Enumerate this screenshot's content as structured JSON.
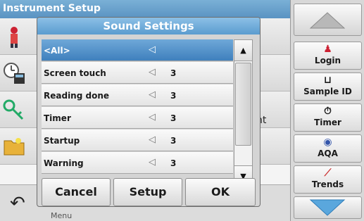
{
  "background": {
    "title": "Instrument Setup",
    "partial_label": "nt",
    "bottom_label": "Menu",
    "back_icon": "undo-icon"
  },
  "dialog": {
    "title": "Sound Settings",
    "rows": [
      {
        "name": "<All>",
        "volume": "",
        "selected": true
      },
      {
        "name": "Screen touch",
        "volume": "3",
        "selected": false
      },
      {
        "name": "Reading done",
        "volume": "3",
        "selected": false
      },
      {
        "name": "Timer",
        "volume": "3",
        "selected": false
      },
      {
        "name": "Startup",
        "volume": "3",
        "selected": false
      },
      {
        "name": "Warning",
        "volume": "3",
        "selected": false
      }
    ],
    "scroll_up": "▲",
    "scroll_down": "▼",
    "buttons": {
      "cancel": "Cancel",
      "setup": "Setup",
      "ok": "OK"
    }
  },
  "sidebar": {
    "login": "Login",
    "sample_id": "Sample ID",
    "timer": "Timer",
    "aqa": "AQA",
    "trends": "Trends"
  },
  "colors": {
    "accent": "#4f8fc7",
    "dialog_bg": "#d4d4d4"
  }
}
